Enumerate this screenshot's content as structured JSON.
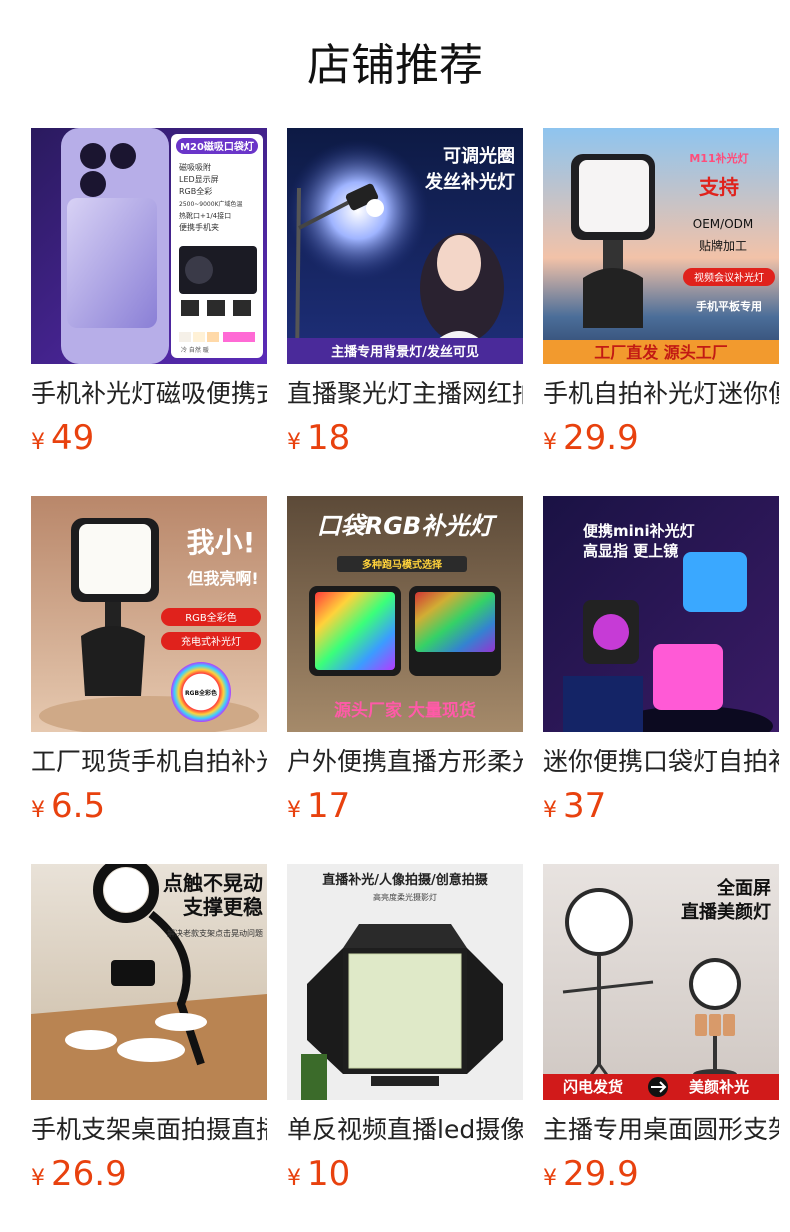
{
  "page_title": "店铺推荐",
  "currency": "¥",
  "products": [
    {
      "name": "手机补光灯磁吸便携式",
      "price": "49",
      "image_text": {
        "badge": "M20磁吸口袋灯",
        "features": [
          "磁吸吸附",
          "LED显示屏",
          "RGB全彩",
          "2500~9000K广域色温",
          "热靴口+1/4接口",
          "便携手机夹"
        ],
        "bottom": "冷  自然  暖"
      }
    },
    {
      "name": "直播聚光灯主播网红拍摄",
      "price": "18",
      "image_text": {
        "headline1": "可调光圈",
        "headline2": "发丝补光灯",
        "banner": "主播专用背景灯/发丝可见"
      }
    },
    {
      "name": "手机自拍补光灯迷你便携",
      "price": "29.9",
      "image_text": {
        "tag": "M11补光灯",
        "headline": "支持",
        "line1": "OEM/ODM",
        "line2": "贴牌加工",
        "pill": "视频会议补光灯",
        "line3": "手机平板专用",
        "banner": "工厂直发 源头工厂"
      }
    },
    {
      "name": "工厂现货手机自拍补光灯",
      "price": "6.5",
      "image_text": {
        "headline1": "我小!",
        "headline2": "但我亮啊!",
        "pill1": "RGB全彩色",
        "pill2": "充电式补光灯",
        "ring": "RGB全彩色"
      }
    },
    {
      "name": "户外便携直播方形柔光灯",
      "price": "17",
      "image_text": {
        "headline": "口袋RGB补光灯",
        "sub": "多种跑马模式选择",
        "banner": "源头厂家  大量现货"
      }
    },
    {
      "name": "迷你便携口袋灯自拍补光",
      "price": "37",
      "image_text": {
        "headline1": "便携mini补光灯",
        "headline2": "高显指 更上镜"
      }
    },
    {
      "name": "手机支架桌面拍摄直播补光",
      "price": "26.9",
      "image_text": {
        "headline1": "点触不晃动",
        "headline2": "支撑更稳",
        "sub": "解决老款支架点击晃动问题"
      }
    },
    {
      "name": "单反视频直播led摄像灯",
      "price": "10",
      "image_text": {
        "headline": "直播补光/人像拍摄/创意拍摄",
        "sub": "高亮度柔光摄影灯"
      }
    },
    {
      "name": "主播专用桌面圆形支架灯",
      "price": "29.9",
      "image_text": {
        "headline1": "全面屏",
        "headline2": "直播美颜灯",
        "banner1": "闪电发货",
        "banner2": "美颜补光"
      }
    }
  ],
  "colors": {
    "price": "#e8410e",
    "title": "#111111",
    "name": "#222222"
  }
}
